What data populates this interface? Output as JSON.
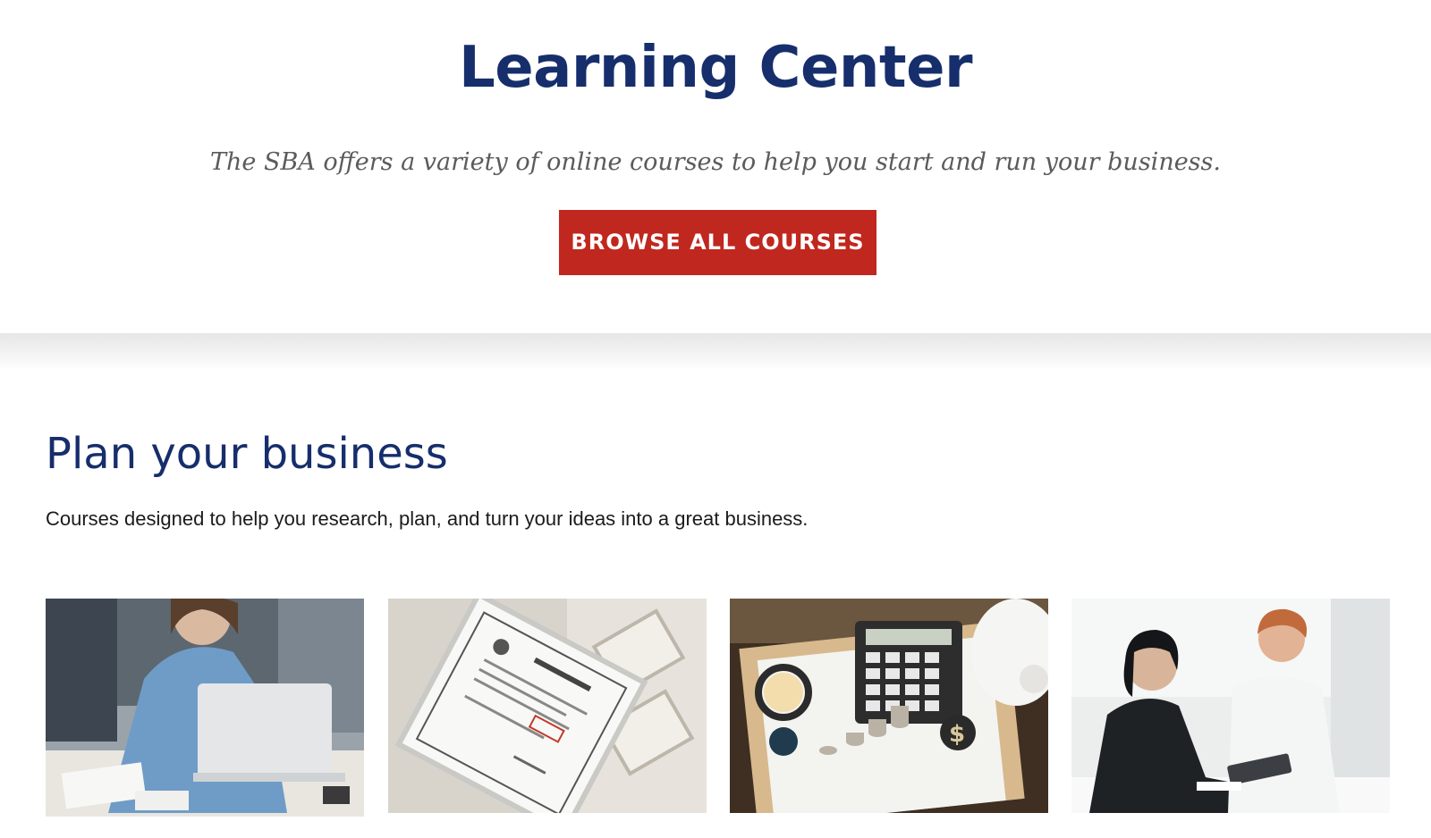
{
  "hero": {
    "title": "Learning Center",
    "subtitle": "The SBA offers a variety of online courses to help you start and run your business.",
    "browse_label": "BROWSE ALL COURSES"
  },
  "section": {
    "title": "Plan your business",
    "description": "Courses designed to help you research, plan, and turn your ideas into a great business."
  },
  "cards": [
    {
      "image": "woman-laptop-photo"
    },
    {
      "image": "business-license-certificate-photo"
    },
    {
      "image": "calculator-coins-piggy-bank-photo"
    },
    {
      "image": "two-colleagues-tablet-photo"
    }
  ],
  "colors": {
    "navy": "#162e6b",
    "red": "#c0271e",
    "subtitle_gray": "#5b5b5b"
  }
}
